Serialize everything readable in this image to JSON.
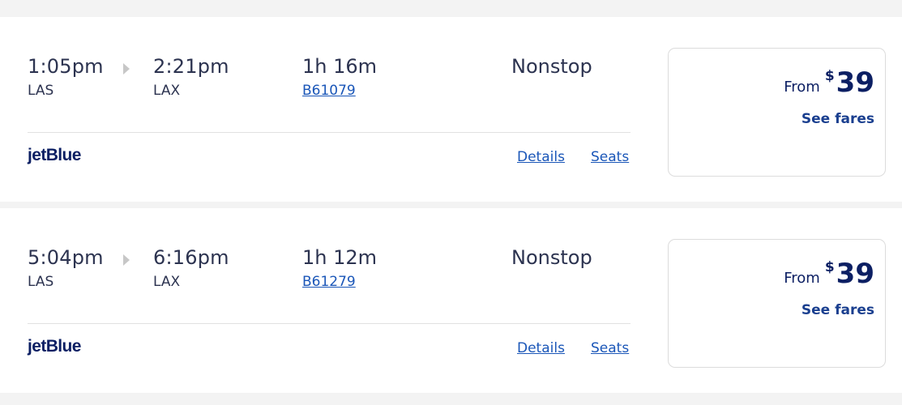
{
  "flights": [
    {
      "depart_time": "1:05pm",
      "depart_code": "LAS",
      "arrive_time": "2:21pm",
      "arrive_code": "LAX",
      "duration": "1h 16m",
      "flight_number": "B61079",
      "stops": "Nonstop",
      "airline": "jetBlue",
      "details_label": "Details",
      "seats_label": "Seats",
      "from_label": "From",
      "currency": "$",
      "price": "39",
      "see_fares_label": "See fares"
    },
    {
      "depart_time": "5:04pm",
      "depart_code": "LAS",
      "arrive_time": "6:16pm",
      "arrive_code": "LAX",
      "duration": "1h 12m",
      "flight_number": "B61279",
      "stops": "Nonstop",
      "airline": "jetBlue",
      "details_label": "Details",
      "seats_label": "Seats",
      "from_label": "From",
      "currency": "$",
      "price": "39",
      "see_fares_label": "See fares"
    }
  ],
  "colors": {
    "navy_text": "#2c3350",
    "brand_navy": "#0c1f63",
    "link_blue": "#1a56b8",
    "page_bg": "#f3f3f3"
  },
  "icons": {
    "route_arrow": "arrow-right-icon"
  }
}
